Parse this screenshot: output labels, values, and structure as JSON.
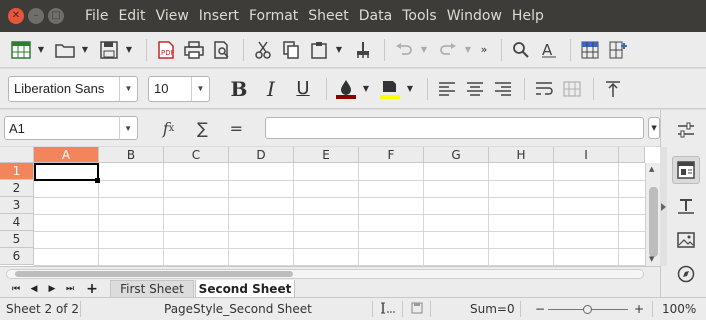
{
  "window": {
    "close_glyph": "✕",
    "minimize_glyph": "–",
    "maximize_glyph": "□"
  },
  "menu": [
    "File",
    "Edit",
    "View",
    "Insert",
    "Format",
    "Sheet",
    "Data",
    "Tools",
    "Window",
    "Help"
  ],
  "toolbar": {
    "font_name": "Liberation Sans",
    "font_size": "10",
    "bold_label": "B",
    "italic_label": "I",
    "underline_label": "U",
    "font_color": "#8b0000",
    "highlight_color": "#ffff00"
  },
  "formula_bar": {
    "name_box": "A1",
    "formula": ""
  },
  "grid": {
    "columns": [
      "A",
      "B",
      "C",
      "D",
      "E",
      "F",
      "G",
      "H",
      "I"
    ],
    "rows": [
      "1",
      "2",
      "3",
      "4",
      "5",
      "6"
    ],
    "selected_cell": "A1",
    "header_highlight_color": "#f3855c"
  },
  "sheets": {
    "tabs": [
      "First Sheet",
      "Second Sheet"
    ],
    "active_index": 1,
    "add_glyph": "+"
  },
  "status": {
    "sheet_info": "Sheet 2 of 2",
    "page_style": "PageStyle_Second Sheet",
    "sum": "Sum=0",
    "zoom_out": "−",
    "zoom_in": "+",
    "zoom": "100%"
  }
}
